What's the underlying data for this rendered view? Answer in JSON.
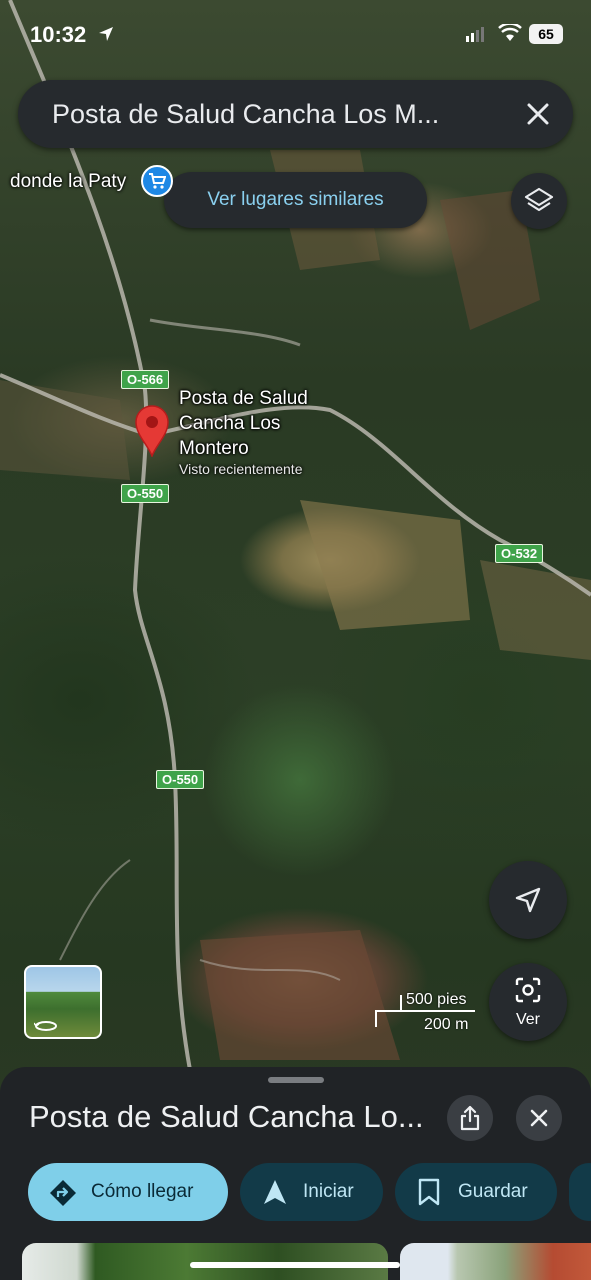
{
  "status_bar": {
    "time": "10:32",
    "battery": "65"
  },
  "search": {
    "query": "Posta de Salud Cancha Los M..."
  },
  "map": {
    "similar_places_label": "Ver lugares similares",
    "poi_label": "donde la Paty",
    "place_label_lines": [
      "Posta de Salud",
      "Cancha Los",
      "Montero"
    ],
    "place_subtitle": "Visto recientemente",
    "roads": [
      "O-566",
      "O-550",
      "O-532",
      "O-550"
    ],
    "scale_top": "500 pies",
    "scale_bottom": "200 m",
    "lens_label": "Ver"
  },
  "sheet": {
    "title": "Posta de Salud Cancha Lo...",
    "actions": {
      "directions": "Cómo llegar",
      "start": "Iniciar",
      "save": "Guardar"
    }
  },
  "colors": {
    "accent_chip": "#7fcfe9",
    "secondary_chip": "#123a48",
    "pin_red": "#e53935",
    "road_badge": "#3fa34a",
    "panel": "#262a2e"
  },
  "icons": [
    "location-arrow-icon",
    "signal-icon",
    "wifi-icon",
    "battery-icon",
    "close-icon",
    "layers-icon",
    "cart-icon",
    "map-pin-icon",
    "navigation-icon",
    "lens-icon",
    "rotate-360-icon",
    "share-icon",
    "directions-icon",
    "start-navigation-icon",
    "bookmark-icon"
  ]
}
